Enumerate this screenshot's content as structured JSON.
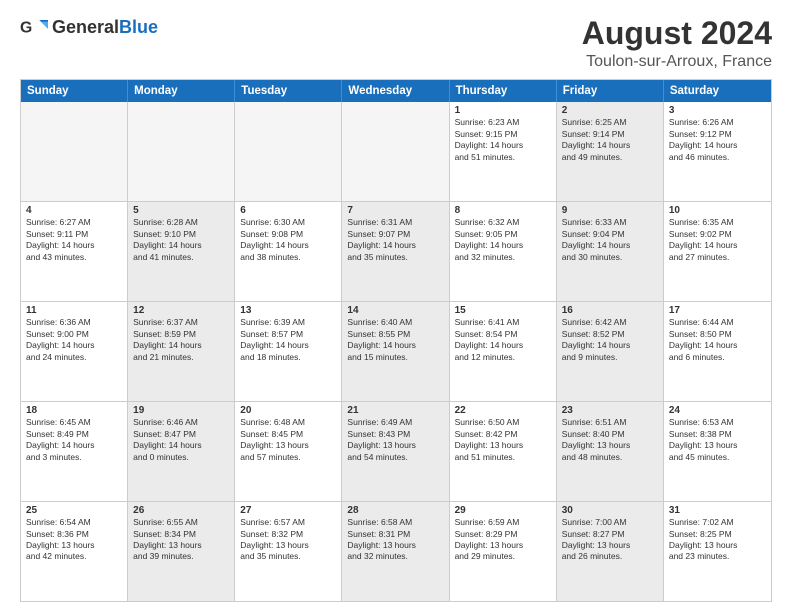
{
  "header": {
    "logo_general": "General",
    "logo_blue": "Blue",
    "title": "August 2024",
    "subtitle": "Toulon-sur-Arroux, France"
  },
  "days_of_week": [
    "Sunday",
    "Monday",
    "Tuesday",
    "Wednesday",
    "Thursday",
    "Friday",
    "Saturday"
  ],
  "weeks": [
    [
      {
        "day": "",
        "info": "",
        "empty": true,
        "shaded": false
      },
      {
        "day": "",
        "info": "",
        "empty": true,
        "shaded": false
      },
      {
        "day": "",
        "info": "",
        "empty": true,
        "shaded": false
      },
      {
        "day": "",
        "info": "",
        "empty": true,
        "shaded": false
      },
      {
        "day": "1",
        "info": "Sunrise: 6:23 AM\nSunset: 9:15 PM\nDaylight: 14 hours\nand 51 minutes.",
        "empty": false,
        "shaded": false
      },
      {
        "day": "2",
        "info": "Sunrise: 6:25 AM\nSunset: 9:14 PM\nDaylight: 14 hours\nand 49 minutes.",
        "empty": false,
        "shaded": true
      },
      {
        "day": "3",
        "info": "Sunrise: 6:26 AM\nSunset: 9:12 PM\nDaylight: 14 hours\nand 46 minutes.",
        "empty": false,
        "shaded": false
      }
    ],
    [
      {
        "day": "4",
        "info": "Sunrise: 6:27 AM\nSunset: 9:11 PM\nDaylight: 14 hours\nand 43 minutes.",
        "empty": false,
        "shaded": false
      },
      {
        "day": "5",
        "info": "Sunrise: 6:28 AM\nSunset: 9:10 PM\nDaylight: 14 hours\nand 41 minutes.",
        "empty": false,
        "shaded": true
      },
      {
        "day": "6",
        "info": "Sunrise: 6:30 AM\nSunset: 9:08 PM\nDaylight: 14 hours\nand 38 minutes.",
        "empty": false,
        "shaded": false
      },
      {
        "day": "7",
        "info": "Sunrise: 6:31 AM\nSunset: 9:07 PM\nDaylight: 14 hours\nand 35 minutes.",
        "empty": false,
        "shaded": true
      },
      {
        "day": "8",
        "info": "Sunrise: 6:32 AM\nSunset: 9:05 PM\nDaylight: 14 hours\nand 32 minutes.",
        "empty": false,
        "shaded": false
      },
      {
        "day": "9",
        "info": "Sunrise: 6:33 AM\nSunset: 9:04 PM\nDaylight: 14 hours\nand 30 minutes.",
        "empty": false,
        "shaded": true
      },
      {
        "day": "10",
        "info": "Sunrise: 6:35 AM\nSunset: 9:02 PM\nDaylight: 14 hours\nand 27 minutes.",
        "empty": false,
        "shaded": false
      }
    ],
    [
      {
        "day": "11",
        "info": "Sunrise: 6:36 AM\nSunset: 9:00 PM\nDaylight: 14 hours\nand 24 minutes.",
        "empty": false,
        "shaded": false
      },
      {
        "day": "12",
        "info": "Sunrise: 6:37 AM\nSunset: 8:59 PM\nDaylight: 14 hours\nand 21 minutes.",
        "empty": false,
        "shaded": true
      },
      {
        "day": "13",
        "info": "Sunrise: 6:39 AM\nSunset: 8:57 PM\nDaylight: 14 hours\nand 18 minutes.",
        "empty": false,
        "shaded": false
      },
      {
        "day": "14",
        "info": "Sunrise: 6:40 AM\nSunset: 8:55 PM\nDaylight: 14 hours\nand 15 minutes.",
        "empty": false,
        "shaded": true
      },
      {
        "day": "15",
        "info": "Sunrise: 6:41 AM\nSunset: 8:54 PM\nDaylight: 14 hours\nand 12 minutes.",
        "empty": false,
        "shaded": false
      },
      {
        "day": "16",
        "info": "Sunrise: 6:42 AM\nSunset: 8:52 PM\nDaylight: 14 hours\nand 9 minutes.",
        "empty": false,
        "shaded": true
      },
      {
        "day": "17",
        "info": "Sunrise: 6:44 AM\nSunset: 8:50 PM\nDaylight: 14 hours\nand 6 minutes.",
        "empty": false,
        "shaded": false
      }
    ],
    [
      {
        "day": "18",
        "info": "Sunrise: 6:45 AM\nSunset: 8:49 PM\nDaylight: 14 hours\nand 3 minutes.",
        "empty": false,
        "shaded": false
      },
      {
        "day": "19",
        "info": "Sunrise: 6:46 AM\nSunset: 8:47 PM\nDaylight: 14 hours\nand 0 minutes.",
        "empty": false,
        "shaded": true
      },
      {
        "day": "20",
        "info": "Sunrise: 6:48 AM\nSunset: 8:45 PM\nDaylight: 13 hours\nand 57 minutes.",
        "empty": false,
        "shaded": false
      },
      {
        "day": "21",
        "info": "Sunrise: 6:49 AM\nSunset: 8:43 PM\nDaylight: 13 hours\nand 54 minutes.",
        "empty": false,
        "shaded": true
      },
      {
        "day": "22",
        "info": "Sunrise: 6:50 AM\nSunset: 8:42 PM\nDaylight: 13 hours\nand 51 minutes.",
        "empty": false,
        "shaded": false
      },
      {
        "day": "23",
        "info": "Sunrise: 6:51 AM\nSunset: 8:40 PM\nDaylight: 13 hours\nand 48 minutes.",
        "empty": false,
        "shaded": true
      },
      {
        "day": "24",
        "info": "Sunrise: 6:53 AM\nSunset: 8:38 PM\nDaylight: 13 hours\nand 45 minutes.",
        "empty": false,
        "shaded": false
      }
    ],
    [
      {
        "day": "25",
        "info": "Sunrise: 6:54 AM\nSunset: 8:36 PM\nDaylight: 13 hours\nand 42 minutes.",
        "empty": false,
        "shaded": false
      },
      {
        "day": "26",
        "info": "Sunrise: 6:55 AM\nSunset: 8:34 PM\nDaylight: 13 hours\nand 39 minutes.",
        "empty": false,
        "shaded": true
      },
      {
        "day": "27",
        "info": "Sunrise: 6:57 AM\nSunset: 8:32 PM\nDaylight: 13 hours\nand 35 minutes.",
        "empty": false,
        "shaded": false
      },
      {
        "day": "28",
        "info": "Sunrise: 6:58 AM\nSunset: 8:31 PM\nDaylight: 13 hours\nand 32 minutes.",
        "empty": false,
        "shaded": true
      },
      {
        "day": "29",
        "info": "Sunrise: 6:59 AM\nSunset: 8:29 PM\nDaylight: 13 hours\nand 29 minutes.",
        "empty": false,
        "shaded": false
      },
      {
        "day": "30",
        "info": "Sunrise: 7:00 AM\nSunset: 8:27 PM\nDaylight: 13 hours\nand 26 minutes.",
        "empty": false,
        "shaded": true
      },
      {
        "day": "31",
        "info": "Sunrise: 7:02 AM\nSunset: 8:25 PM\nDaylight: 13 hours\nand 23 minutes.",
        "empty": false,
        "shaded": false
      }
    ]
  ]
}
